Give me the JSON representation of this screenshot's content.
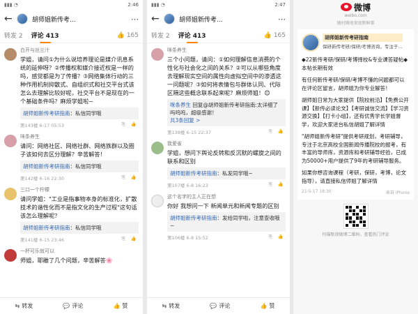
{
  "panel1": {
    "status_time": "2:46",
    "title": "胡师姐新传考...",
    "tabs": {
      "repost": "转发 2",
      "comment": "评论 413",
      "likes": "165"
    },
    "comments": [
      {
        "name": "白开与丝兰汁",
        "text": "学姐，请问①为什么说培养理论是媒介讯息系统的延伸呀？②传播权和媒介接近权是一样的吗，感觉都是为了传播？③网络集体行动的三种作用机制抑散式、自组织式和社交平台式该怎么去理解比较好呢，社交平台不是现在的一个基础条件吗？麻烦学姐啦~",
        "reply_author": "胡师姐新传考研指南",
        "reply_text": "私信同学哦",
        "meta": "第143楼 6-17 05:53"
      },
      {
        "name": "咪条养生",
        "text": "请问：网络社区、网络社群、网络族群以及圈子该如何去区分理解？辛苦解答！",
        "reply_author": "胡师姐新传考研指南",
        "reply_text": "私信同学哦",
        "meta": "第142楼 6-16 22:30"
      },
      {
        "name": "三口一个柠檬",
        "text": "请问学姐：\"工业是指事物本身的标准化，扩散技术的谐性化而不是指文化的生产过程\"这句话该怎么理解呢？",
        "reply_author": "胡师姐新传考研指南",
        "reply_text": "私信同学哦",
        "meta": "第141楼 6-15 23:46"
      },
      {
        "name": "一杯可乐就可以",
        "text": "师姐，耶雕了几个问题，辛苦解答🌸",
        "meta": ""
      }
    ],
    "bottom": {
      "repost": "转发",
      "comment": "评论",
      "like": "赞"
    }
  },
  "panel2": {
    "status_time": "2:47",
    "title": "胡师姐新传考...",
    "tabs": {
      "repost": "转发 2",
      "comment": "评论 413",
      "likes": "165"
    },
    "comments": [
      {
        "name": "咪条养生",
        "text": "三个小问题，请问：①如何理解信息消费的个性化与社会化之间的关系？②可以从哪些角度去理解现实空间的属性向虚拟空间中的渗透这一问题呢？③如何将表情包与群体认同、代际区隔这些概念联系起来呢？麻烦师姐！😊",
        "reply_author": "咪条养生",
        "reply_text": "回复@胡师姐新传考研指南:太详细了吗呜呜，超级感谢！",
        "reply_more": "共3条回复 >",
        "meta": "第138楼 6-15 22:37"
      },
      {
        "name": "我爱雀",
        "text": "学姐，想问下舆论反转和反沉默的螺旋之间的联系和区别",
        "reply_author": "胡师姐新传考研指南",
        "reply_text": "私发同学哦~",
        "meta": "第107楼 6-8 16:23"
      },
      {
        "name": "这个名字的主人正在想",
        "text": "你好 我想问一下 新闻单元和新闻专题的区别",
        "reply_author": "胡师姐新传考研指南",
        "reply_text": "发给同学啦，注意查收哦~",
        "meta": "第106楼 6-8 15:52"
      }
    ],
    "bottom": {
      "repost": "转发",
      "comment": "评论",
      "like": "赞"
    }
  },
  "panel3": {
    "brand": "微博",
    "url": "weibo.com",
    "sub": "随时随地发现新鲜事",
    "profile_name": "胡师姐新传考研指南",
    "profile_desc": "保研新传考研/保研/考博咨询，专注于...",
    "post_lines": [
      "◆22新传考研/保研/考博择校&专业课答疑帖◆本帖长期有效",
      "有任何新传考研/保研/考博不懂的问题都可以在评论区留言，胡师姐为你专业解答！",
      "胡师姐日常为大家提供【院校前沿】【免费公开课】【新传必读论文】【考研诚信交流】【学习资源交换】【打卡小组】，还有优秀学长学姐督学，欢迎大家进台私信胡姐了解详情",
      "\"胡师姐新传考研\"提供考研规划，考研辅导，专注于北京高校全国新闻传播院校的报考，有丰富的导师库，资源库和考研辅导经验，已成为50000+用户提供了9年的考研辅导服务。",
      "如果你想咨询课程（考研，保研，考博，论文指导），请直接私信师姐了解详情"
    ],
    "post_time": "21-5-17 18:30",
    "post_source": "来自 iPhone",
    "qr_caption": "扫描新浪微博二维码，查看热门评论"
  },
  "colors": {
    "accent": "#ff8200",
    "link": "#3467b5",
    "weibo_red": "#e6162d"
  }
}
